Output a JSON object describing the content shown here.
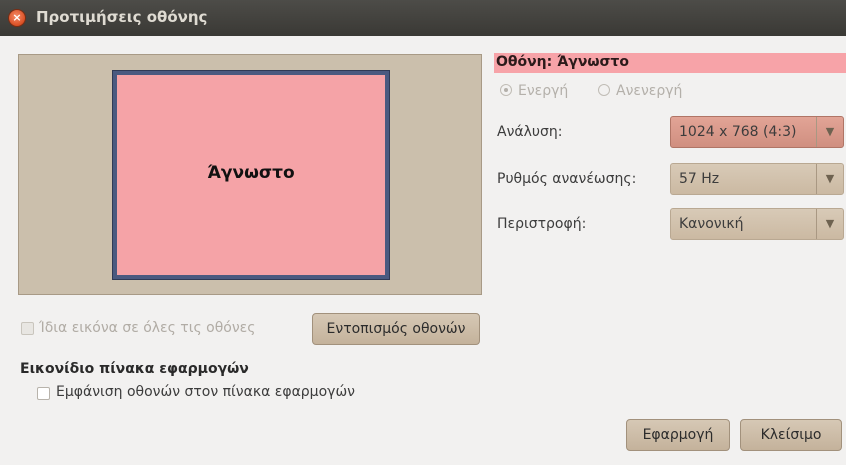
{
  "window": {
    "title": "Προτιμήσεις οθόνης"
  },
  "preview": {
    "monitor_label": "Άγνωστο"
  },
  "monitor": {
    "name": "Οθόνη: Άγνωστο",
    "state_on": "Ενεργή",
    "state_off": "Ανενεργή",
    "resolution_label": "Ανάλυση:",
    "resolution_value": "1024 x 768 (4:3)",
    "refresh_label": "Ρυθμός ανανέωσης:",
    "refresh_value": "57 Hz",
    "rotation_label": "Περιστροφή:",
    "rotation_value": "Κανονική"
  },
  "options": {
    "mirror_label": "Ίδια εικόνα σε όλες τις οθόνες",
    "detect_button": "Εντοπισμός οθονών",
    "panel_heading": "Εικονίδιο πίνακα εφαρμογών",
    "panel_show_label": "Εμφάνιση οθονών στον πίνακα εφαρμογών"
  },
  "buttons": {
    "apply": "Εφαρμογή",
    "close": "Κλείσιμο"
  },
  "colors": {
    "monitor_fill": "#f5a3a7",
    "titlebar": "#3f3e3a",
    "button": "#cbb9a2"
  }
}
